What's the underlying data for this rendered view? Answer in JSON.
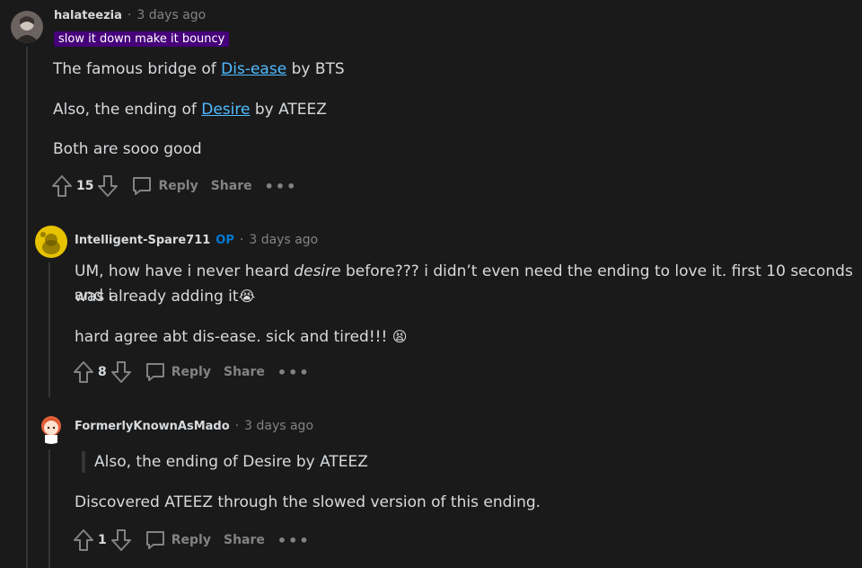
{
  "comments": [
    {
      "username": "halateezia",
      "time": "3 days ago",
      "flair": "slow it down make it bouncy",
      "paragraphs": [
        {
          "prefix": "The famous bridge of ",
          "link": "Dis-ease",
          "suffix": " by BTS"
        },
        {
          "prefix": "Also, the ending of ",
          "link": "Desire",
          "suffix": " by ATEEZ"
        },
        {
          "text": "Both are sooo good"
        }
      ],
      "votes": "15",
      "reply_label": "Reply",
      "share_label": "Share",
      "more_label": "•••"
    },
    {
      "username": "Intelligent-Spare711",
      "op_badge": "OP",
      "time": "3 days ago",
      "paragraphs": [
        {
          "prefix": "UM, how have i never heard ",
          "italic": "desire",
          "suffix": " before??? i didn’t even need the ending to love it. first 10 seconds and i"
        },
        {
          "text": "was already adding it",
          "emoji": "😭"
        },
        {
          "text": "hard agree abt dis-ease. sick and tired!!!",
          "emoji": "😫"
        }
      ],
      "votes": "8",
      "reply_label": "Reply",
      "share_label": "Share",
      "more_label": "•••"
    },
    {
      "username": "FormerlyKnownAsMado",
      "time": "3 days ago",
      "quote": "Also, the ending of Desire by ATEEZ",
      "paragraphs": [
        {
          "text": "Discovered ATEEZ through the slowed version of this ending."
        }
      ],
      "votes": "1",
      "reply_label": "Reply",
      "share_label": "Share",
      "more_label": "•••"
    }
  ],
  "separator": "·",
  "colors": {
    "background": "#1a1a1b",
    "text": "#d7dadc",
    "muted": "#818384",
    "link": "#4fbcff",
    "flair": "#46007a",
    "op": "#0079d3"
  }
}
